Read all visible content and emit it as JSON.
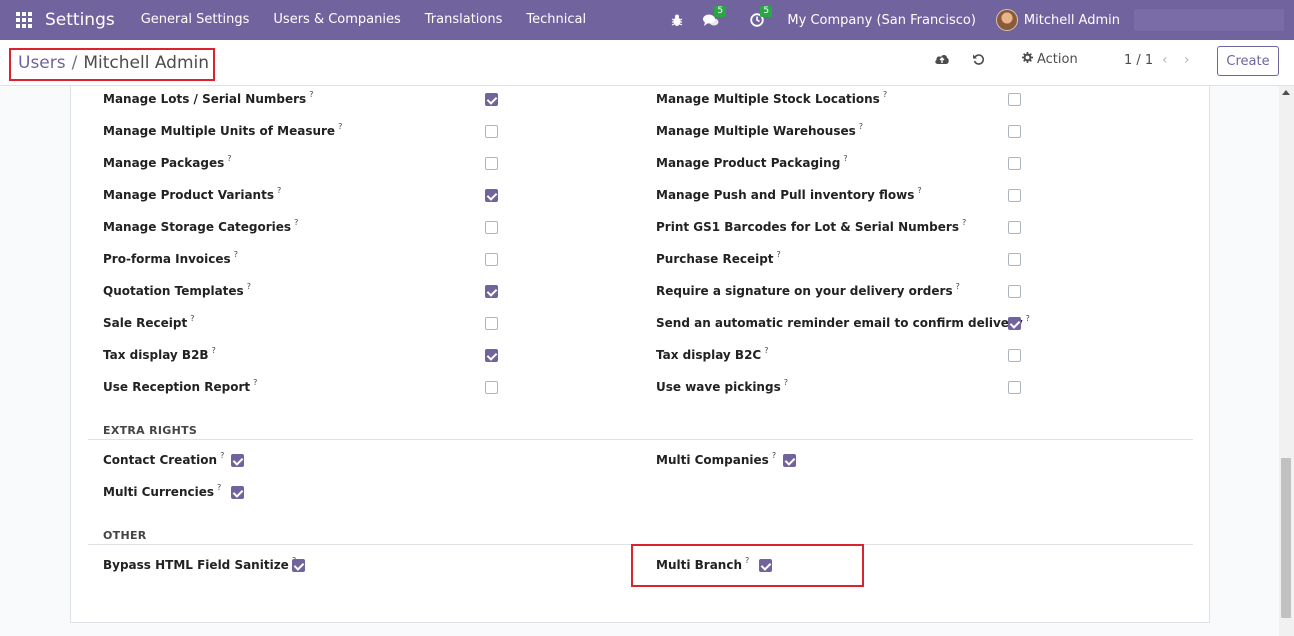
{
  "navbar": {
    "app_title": "Settings",
    "menu": [
      "General Settings",
      "Users & Companies",
      "Translations",
      "Technical"
    ],
    "messages_count": "5",
    "activities_count": "5",
    "company": "My Company (San Francisco)",
    "user": "Mitchell Admin"
  },
  "breadcrumb": {
    "parent": "Users",
    "separator": "/",
    "current": "Mitchell Admin"
  },
  "toolbar": {
    "action_label": "Action",
    "pager": "1 / 1",
    "create_label": "Create"
  },
  "settings_left": [
    {
      "label": "Manage Lots / Serial Numbers",
      "checked": true
    },
    {
      "label": "Manage Multiple Units of Measure",
      "checked": false
    },
    {
      "label": "Manage Packages",
      "checked": false
    },
    {
      "label": "Manage Product Variants",
      "checked": true
    },
    {
      "label": "Manage Storage Categories",
      "checked": false
    },
    {
      "label": "Pro-forma Invoices",
      "checked": false
    },
    {
      "label": "Quotation Templates",
      "checked": true
    },
    {
      "label": "Sale Receipt",
      "checked": false
    },
    {
      "label": "Tax display B2B",
      "checked": true
    },
    {
      "label": "Use Reception Report",
      "checked": false
    }
  ],
  "settings_right": [
    {
      "label": "Manage Multiple Stock Locations",
      "checked": false
    },
    {
      "label": "Manage Multiple Warehouses",
      "checked": false
    },
    {
      "label": "Manage Product Packaging",
      "checked": false
    },
    {
      "label": "Manage Push and Pull inventory flows",
      "checked": false
    },
    {
      "label": "Print GS1 Barcodes for Lot & Serial Numbers",
      "checked": false
    },
    {
      "label": "Purchase Receipt",
      "checked": false
    },
    {
      "label": "Require a signature on your delivery orders",
      "checked": false
    },
    {
      "label": "Send an automatic reminder email to confirm delivery",
      "checked": true
    },
    {
      "label": "Tax display B2C",
      "checked": false
    },
    {
      "label": "Use wave pickings",
      "checked": false
    }
  ],
  "extra_rights": {
    "title": "EXTRA RIGHTS",
    "items": [
      {
        "label": "Contact Creation",
        "checked": true
      },
      {
        "label": "Multi Companies",
        "checked": true
      },
      {
        "label": "Multi Currencies",
        "checked": true
      }
    ]
  },
  "other": {
    "title": "OTHER",
    "items": [
      {
        "label": "Bypass HTML Field Sanitize",
        "checked": true
      },
      {
        "label": "Multi Branch",
        "checked": true
      }
    ]
  },
  "help_mark": "?",
  "colors": {
    "brand": "#71639e",
    "highlight": "#d9232e",
    "badge": "#28a745"
  }
}
